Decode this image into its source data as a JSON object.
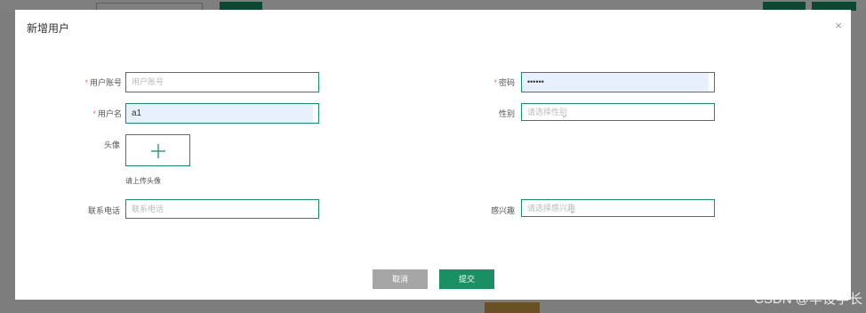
{
  "dialog": {
    "title": "新增用户",
    "close_glyph": "×"
  },
  "form": {
    "required_mark": "*",
    "account": {
      "label": "用户账号",
      "placeholder": "用户账号",
      "value": ""
    },
    "password": {
      "label": "密码",
      "value": "••••••"
    },
    "username": {
      "label": "用户名",
      "value": "a1"
    },
    "gender": {
      "label": "性别",
      "placeholder": "请选择性别",
      "value": ""
    },
    "avatar": {
      "label": "头像",
      "tip": "请上传头像"
    },
    "phone": {
      "label": "联系电话",
      "placeholder": "联系电话",
      "value": ""
    },
    "interest": {
      "label": "感兴趣",
      "placeholder": "请选择感兴趣",
      "value": ""
    }
  },
  "buttons": {
    "cancel": "取消",
    "submit": "提交"
  },
  "watermark": "CSDN @毕设学长",
  "icons": {
    "close": "close-icon",
    "dropdown": "chevron-down-icon",
    "upload": "plus-icon"
  },
  "colors": {
    "accent": "#1a8f63",
    "required": "#f56c6c",
    "cancel": "#a6a6a6",
    "autofill": "#e8f0fe"
  }
}
